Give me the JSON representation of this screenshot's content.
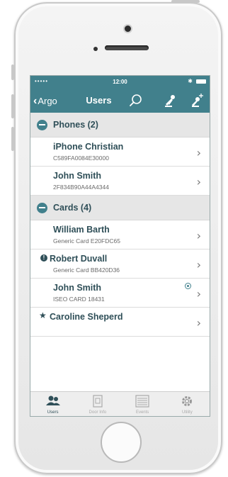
{
  "status_bar": {
    "signal": "•••••",
    "time": "12:00",
    "bluetooth": "✱"
  },
  "nav": {
    "back_label": "Argo",
    "title": "Users",
    "icons": [
      "search-icon",
      "key-icon",
      "add-key-icon"
    ]
  },
  "sections": [
    {
      "label": "Phones (2)",
      "items": [
        {
          "name": "iPhone Christian",
          "subtitle": "C589FA0084E30000"
        },
        {
          "name": "John Smith",
          "subtitle": "2F834B90A44A4344"
        }
      ]
    },
    {
      "label": "Cards (4)",
      "items": [
        {
          "name": "William Barth",
          "subtitle": "Generic Card E20FDC65"
        },
        {
          "name": "Robert Duvall",
          "subtitle": "Generic Card BB420D36",
          "marker": "exclamation-icon"
        },
        {
          "name": "John Smith",
          "subtitle": "ISEO CARD 18431",
          "badge": "target-icon"
        },
        {
          "name": "Caroline Sheperd",
          "subtitle": "",
          "marker": "star-icon"
        }
      ]
    }
  ],
  "tabs": [
    {
      "label": "Users",
      "icon": "users-icon",
      "active": true
    },
    {
      "label": "Door Info",
      "icon": "door-icon",
      "active": false
    },
    {
      "label": "Events",
      "icon": "list-icon",
      "active": false
    },
    {
      "label": "Utility",
      "icon": "gear-icon",
      "active": false
    }
  ],
  "colors": {
    "accent": "#41808c",
    "text_dark": "#2f4f58",
    "section_bg": "#e6e6e6"
  }
}
